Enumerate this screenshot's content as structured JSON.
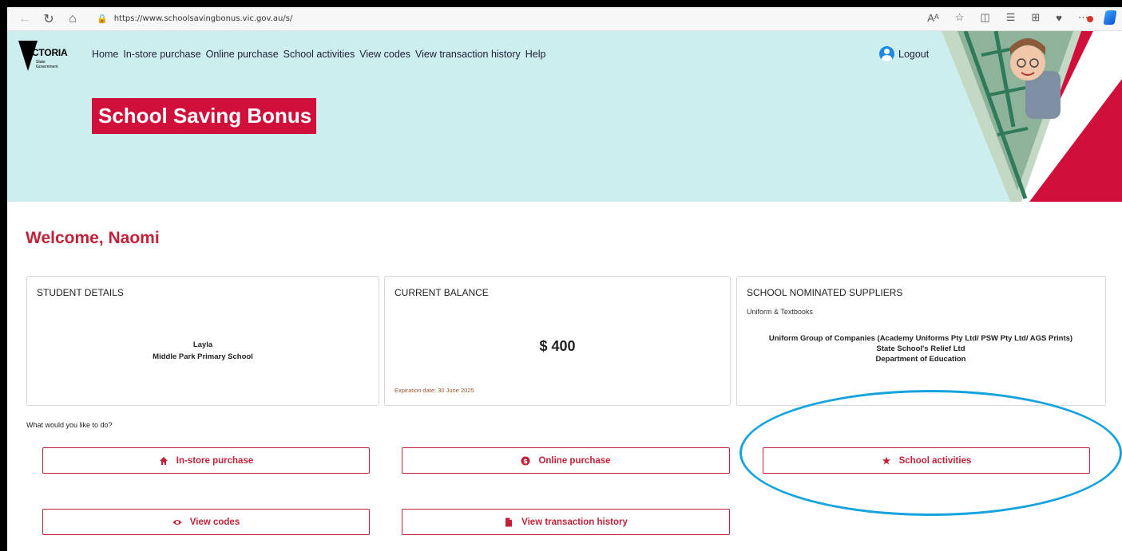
{
  "browser": {
    "url": "https://www.schoolsavingbonus.vic.gov.au/s/",
    "read_aloud_label": "Aᴬ"
  },
  "logo": {
    "word": "VICTORIA",
    "sub": "State Government"
  },
  "nav": {
    "items": [
      "Home",
      "In-store purchase",
      "Online purchase",
      "School activities",
      "View codes",
      "View transaction history",
      "Help"
    ],
    "logout": "Logout"
  },
  "hero": {
    "title": "School Saving Bonus"
  },
  "welcome": "Welcome, Naomi",
  "student": {
    "heading": "STUDENT DETAILS",
    "name": "Layla",
    "school": "Middle Park Primary School"
  },
  "balance": {
    "heading": "CURRENT BALANCE",
    "amount": "$ 400",
    "expiry": "Expiration date: 30 June 2025"
  },
  "suppliers": {
    "heading": "SCHOOL NOMINATED SUPPLIERS",
    "category": "Uniform & Textbooks",
    "list": [
      "Uniform Group of Companies (Academy Uniforms Pty Ltd/ PSW Pty Ltd/ AGS Prints)",
      "State School's Relief Ltd",
      "Department of Education"
    ]
  },
  "prompt": "What would you like to do?",
  "actions": {
    "instore": "In-store purchase",
    "online": "Online purchase",
    "activities": "School activities",
    "codes": "View codes",
    "history": "View transaction history"
  },
  "colors": {
    "brand_red": "#c0223a",
    "hero_bg": "#cdeeee",
    "highlight": "#16a3dd"
  }
}
